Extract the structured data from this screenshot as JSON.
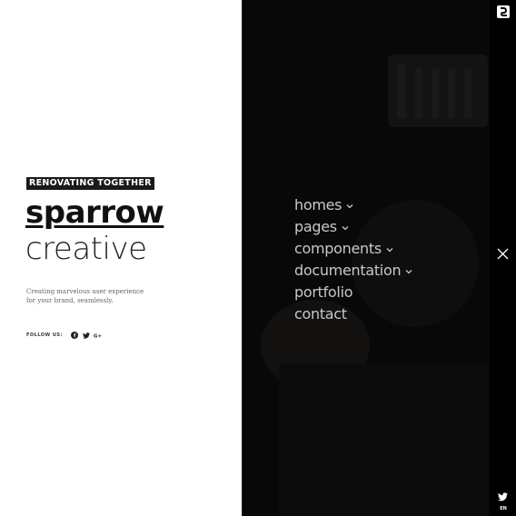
{
  "hero": {
    "tagline": "RENOVATING TOGETHER",
    "brand_line1": "sparrow",
    "brand_line2": "creative",
    "description": "Creating marvelous user experience for your brand, seamlessly."
  },
  "social": {
    "follow_label": "FOLLOW US:",
    "icons": [
      "facebook-icon",
      "twitter-icon",
      "google-plus-icon"
    ]
  },
  "menu": {
    "items": [
      {
        "label": "homes",
        "has_submenu": true
      },
      {
        "label": "pages",
        "has_submenu": true
      },
      {
        "label": "components",
        "has_submenu": true
      },
      {
        "label": "documentation",
        "has_submenu": true
      },
      {
        "label": "portfolio",
        "has_submenu": false
      },
      {
        "label": "contact",
        "has_submenu": false
      }
    ]
  },
  "rail": {
    "language": "EN"
  },
  "colors": {
    "panel_bg": "#080808",
    "rail_bg": "#000000",
    "menu_text": "#c8c8c8",
    "tag_bg": "#1a1a1a"
  }
}
